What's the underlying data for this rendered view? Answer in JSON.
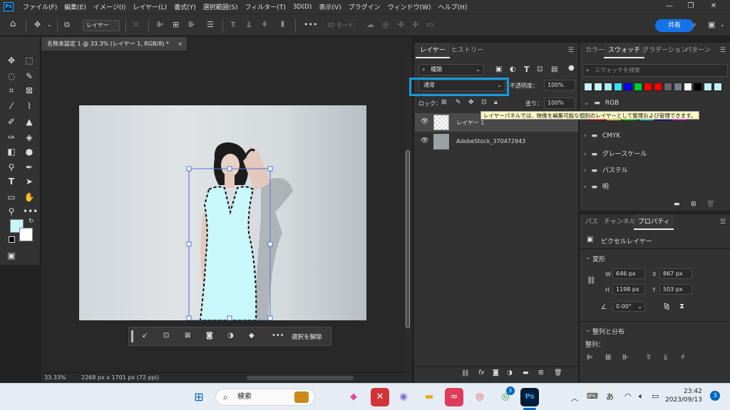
{
  "menubar": {
    "app_logo": "Ps",
    "items": [
      "ファイル(F)",
      "編集(E)",
      "イメージ(I)",
      "レイヤー(L)",
      "書式(Y)",
      "選択範囲(S)",
      "フィルター(T)",
      "3D(D)",
      "表示(V)",
      "プラグイン",
      "ウィンドウ(W)",
      "ヘルプ(H)"
    ],
    "window_controls": [
      "—",
      "❐",
      "✕"
    ]
  },
  "optionsbar": {
    "layer_dropdown": "レイヤー",
    "mode_3d": "3D モード：",
    "share_label": "共有"
  },
  "document": {
    "tab_title": "名称未設定 1 @ 33.3% (レイヤー 1, RGB/8) *",
    "zoom": "33.33%",
    "size_info": "2268 px x 1701 px (72 ppi)"
  },
  "context_bar": {
    "deselect_label": "選択を解除"
  },
  "layers_panel": {
    "tabs": [
      "レイヤー",
      "ヒストリー"
    ],
    "filter_label": "種類",
    "blend_mode": "通常",
    "opacity_label": "不透明度：",
    "opacity_value": "100%",
    "lock_label": "ロック：",
    "fill_label": "塗り：",
    "fill_value": "100%",
    "layers": [
      {
        "name": "レイヤー 1"
      },
      {
        "name": "AdobeStock_370472943"
      }
    ],
    "tooltip": "レイヤーパネルでは、映像を編集可能な個別のレイヤーとして整理および管理できます。"
  },
  "swatches_panel": {
    "tabs": [
      "カラー",
      "スウォッチ",
      "グラデーション",
      "パターン"
    ],
    "search_placeholder": "スウォッチを検索",
    "recent_colors": [
      "#c8f5fa",
      "#c8f5fa",
      "#a8eef5",
      "#3ae0f5",
      "#0000ff",
      "#00cc33",
      "#ff0000",
      "#ff0000",
      "#666666",
      "#6f8090",
      "#ffffff",
      "#000000",
      "#bff4ff",
      "#bff4ff"
    ],
    "groups": [
      {
        "name": "RGB",
        "colors": [
          "#ff0000",
          "#ffff00",
          "#00ff00",
          "#00ffff",
          "#0000ff",
          "#ff00ff"
        ]
      },
      {
        "name": "CMYK"
      },
      {
        "name": "グレースケール"
      },
      {
        "name": "パステル"
      },
      {
        "name": "明"
      }
    ]
  },
  "properties_panel": {
    "tabs": [
      "パス",
      "チャンネル",
      "プロパティ"
    ],
    "layer_type": "ピクセルレイヤー",
    "transform_label": "変形",
    "w_label": "W",
    "w_value": "646 px",
    "h_label": "H",
    "h_value": "1198 px",
    "x_label": "X",
    "x_value": "867 px",
    "y_label": "Y",
    "y_value": "503 px",
    "angle_value": "0.00°",
    "align_label": "整列と分布",
    "align_sub_label": "整列："
  },
  "taskbar": {
    "search_placeholder": "検索",
    "time": "23:42",
    "date": "2023/09/13",
    "ime": "あ",
    "notification_count": "3",
    "chrome_badge": "5"
  }
}
